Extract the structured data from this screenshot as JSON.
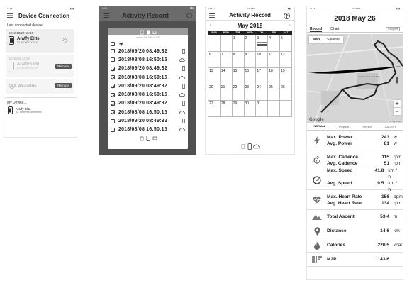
{
  "phone1": {
    "header": {
      "title": "Device Connection"
    },
    "last_connected_label": "Last connected device:",
    "devices": [
      {
        "date": "2018/10/27 15:46",
        "name": "Araffy Elite",
        "id": "ID: XXXXXXXXXX",
        "state": "connecting"
      },
      {
        "date": "2018/9/5 14:16",
        "name": "Araffy Link",
        "id": "ID: XXXXXXXXXX",
        "remove_label": "Remove"
      },
      {
        "name": "Wearable",
        "remove_label": "Remove"
      }
    ],
    "my_devices_label": "My Device...",
    "my_device": {
      "name": "Araffy Elite",
      "id": "ID: 7999999999999999"
    }
  },
  "phone2": {
    "header": {
      "title": "Activity Record"
    },
    "upload_note": "upload file 100 of 100",
    "records": [
      {
        "datetime": "2018/09/20 08:49:32",
        "checked": false,
        "device": "phone"
      },
      {
        "datetime": "2018/08/08 16:50:15",
        "checked": false,
        "device": "cloud"
      },
      {
        "datetime": "2018/09/20 08:49:32",
        "checked": true,
        "device": "phone"
      },
      {
        "datetime": "2018/08/08 16:50:15",
        "checked": true,
        "device": "cloud"
      },
      {
        "datetime": "2018/09/20 08:49:32",
        "checked": true,
        "device": "phone"
      },
      {
        "datetime": "2018/08/08 16:50:15",
        "checked": true,
        "device": "cloud"
      },
      {
        "datetime": "2018/09/20 08:49:32",
        "checked": true,
        "device": "phone"
      },
      {
        "datetime": "2018/08/08 16:50:15",
        "checked": true,
        "device": "cloud"
      },
      {
        "datetime": "2018/09/20 08:49:32",
        "checked": false,
        "device": "phone"
      },
      {
        "datetime": "2018/08/08 16:50:15",
        "checked": false,
        "device": "cloud"
      }
    ]
  },
  "phone3": {
    "status_time": "7:07 AM",
    "header": {
      "title": "Activity Record"
    },
    "month": "May 2018",
    "weekdays": [
      "SUN",
      "MON",
      "TUE",
      "WED",
      "THU",
      "FRI",
      "SAT"
    ],
    "weeks": [
      [
        "",
        "",
        "1",
        "2",
        "3",
        "4",
        "5"
      ],
      [
        "6",
        "7",
        "8",
        "9",
        "10",
        "11",
        "12"
      ],
      [
        "13",
        "14",
        "15",
        "16",
        "17",
        "18",
        "19"
      ],
      [
        "20",
        "21",
        "22",
        "23",
        "24",
        "25",
        "26"
      ],
      [
        "27",
        "28",
        "29",
        "30",
        "31",
        "",
        ""
      ]
    ]
  },
  "phone4": {
    "status_time": "7:37 AM",
    "date_title": "2018 May 26",
    "tabs": [
      "Record",
      "Chart"
    ],
    "map_source": "Google",
    "map_types": [
      "Map",
      "Satellite"
    ],
    "map_labels": [
      "Golden Dune Golf Club",
      "Terms of Use"
    ],
    "logo": "Google",
    "zoom_in": "+",
    "zoom_out": "−",
    "subtabs": [
      "NORMAL",
      "POWER",
      "SPEED",
      "ASCENT"
    ],
    "stats": [
      {
        "icon": "bolt-icon",
        "lines": [
          {
            "label": "Max. Power",
            "value": "243",
            "unit": "w"
          },
          {
            "label": "Avg. Power",
            "value": "81",
            "unit": "w"
          }
        ]
      },
      {
        "icon": "cadence-icon",
        "lines": [
          {
            "label": "Max. Cadence",
            "value": "115",
            "unit": "rpm"
          },
          {
            "label": "Avg. Cadence",
            "value": "51",
            "unit": "rpm"
          }
        ]
      },
      {
        "icon": "speedometer-icon",
        "lines": [
          {
            "label": "Max. Speed",
            "value": "41.8",
            "unit": "km / h"
          },
          {
            "label": "Avg. Speed",
            "value": "9.5",
            "unit": "km / h"
          }
        ]
      },
      {
        "icon": "heart-icon",
        "lines": [
          {
            "label": "Max. Heart Rate",
            "value": "156",
            "unit": "bpm"
          },
          {
            "label": "Avg. Heart Rate",
            "value": "134",
            "unit": "rpm"
          }
        ]
      },
      {
        "icon": "mountain-icon",
        "lines": [
          {
            "label": "Total Ascent",
            "value": "53.4",
            "unit": "m"
          }
        ]
      },
      {
        "icon": "location-pin-icon",
        "lines": [
          {
            "label": "Distance",
            "value": "14.6",
            "unit": "km"
          }
        ]
      },
      {
        "icon": "flame-icon",
        "lines": [
          {
            "label": "Calories",
            "value": "220.5",
            "unit": "kcal"
          }
        ]
      },
      {
        "icon": "m2p-icon",
        "lines": [
          {
            "label": "M2P",
            "value": "143.6",
            "unit": ""
          }
        ]
      }
    ]
  }
}
